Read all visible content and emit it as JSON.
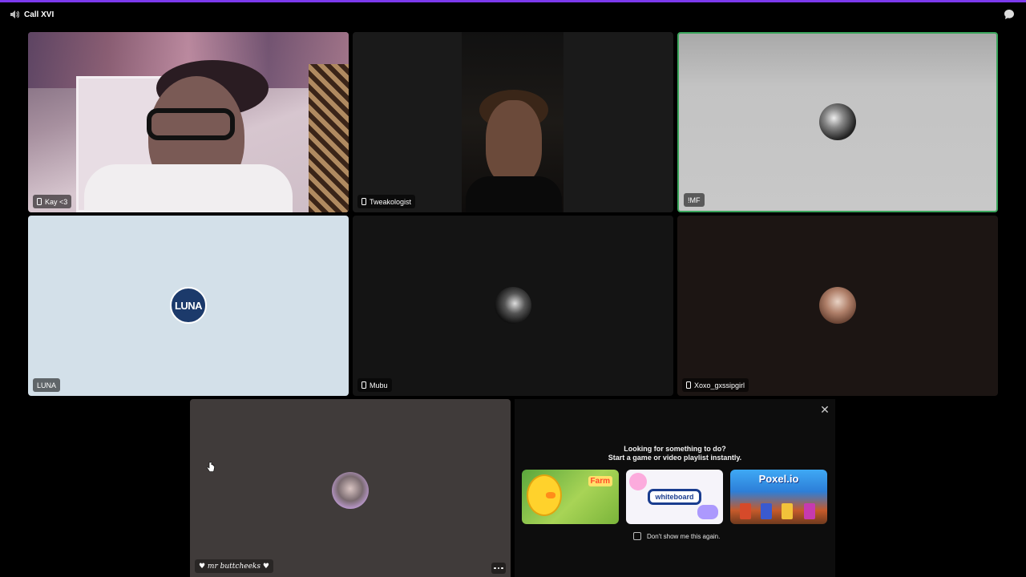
{
  "window": {
    "title": "Call XVI",
    "speaker_icon": "speaker-icon",
    "chat_icon": "chat-bubble-icon",
    "accent_color": "#7c3aed"
  },
  "participants": [
    {
      "name": "Kay <3",
      "mobile": true,
      "video": true
    },
    {
      "name": "Tweakologist",
      "mobile": true,
      "video": true
    },
    {
      "name": "!MF",
      "mobile": false,
      "video": false,
      "speaking": true
    },
    {
      "name": "LUNA",
      "mobile": false,
      "video": false,
      "avatar_text": "LUNA"
    },
    {
      "name": "Mubu",
      "mobile": true,
      "video": false
    },
    {
      "name": "Xoxo_gxssipgirl",
      "mobile": true,
      "video": false
    },
    {
      "name": "♥ mr buttcheeks ♥",
      "mobile": false,
      "video": false
    }
  ],
  "activity_panel": {
    "heading_line1": "Looking for something to do?",
    "heading_line2": "Start a game or video playlist instantly.",
    "activities": [
      {
        "title": "Farm",
        "icon": "farm-game-icon"
      },
      {
        "title": "whiteboard",
        "icon": "whiteboard-icon"
      },
      {
        "title": "Poxel.io",
        "icon": "poxel-game-icon"
      }
    ],
    "dont_show_label": "Don't show me this again.",
    "dont_show_checked": false
  },
  "colors": {
    "speaking_border": "#3ba55c",
    "luna_tile": "#d3e0e9"
  }
}
